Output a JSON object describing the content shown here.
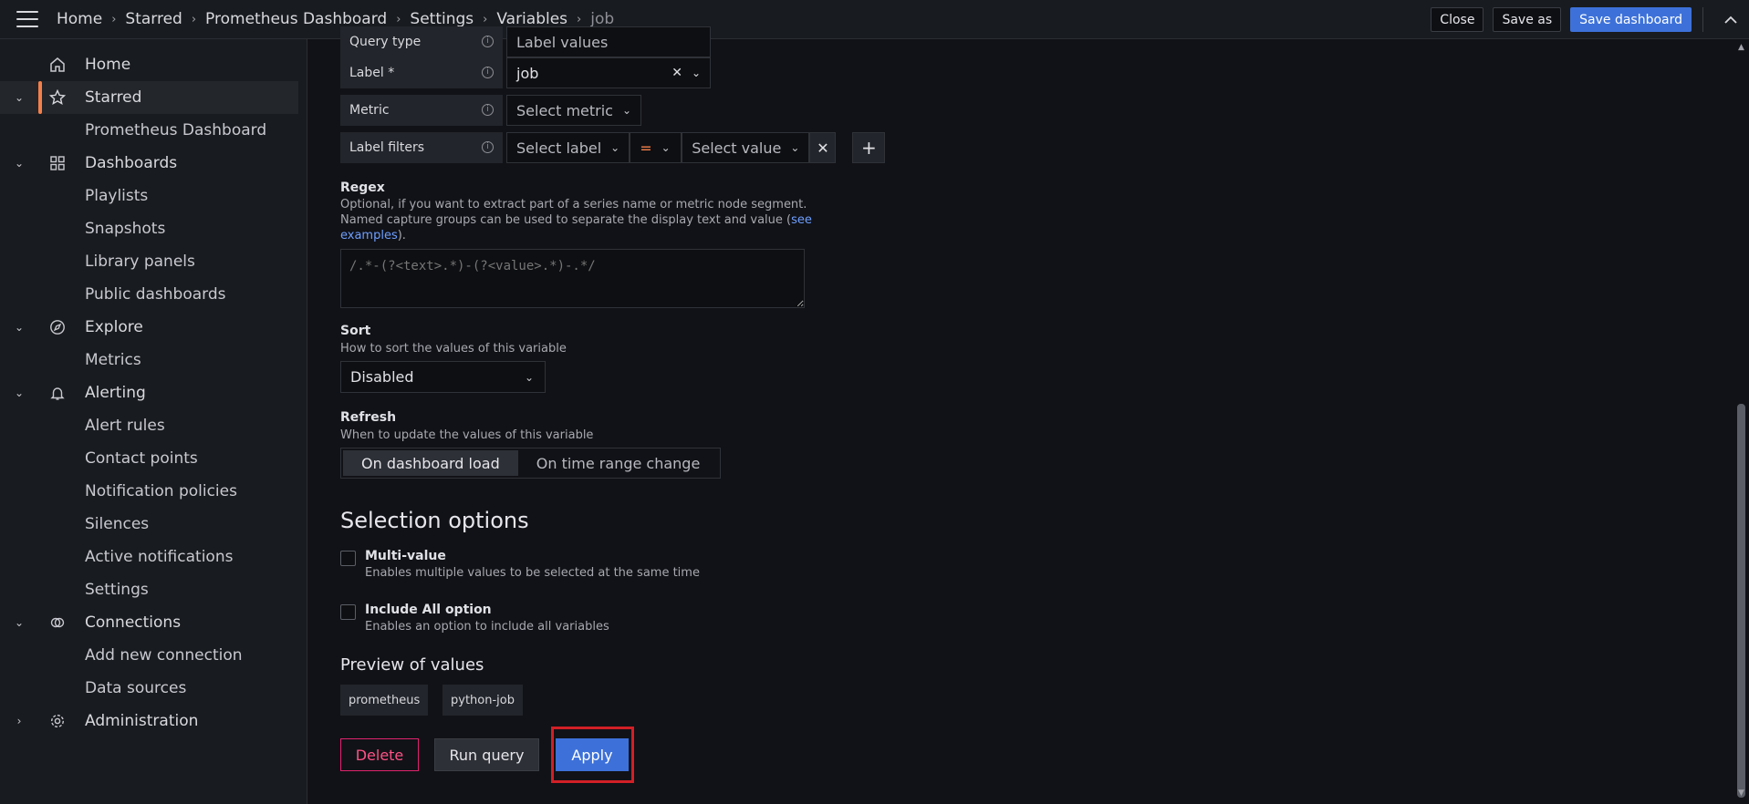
{
  "topbar": {
    "breadcrumb": [
      "Home",
      "Starred",
      "Prometheus Dashboard",
      "Settings",
      "Variables",
      "job"
    ],
    "close_label": "Close",
    "save_as_label": "Save as",
    "save_dashboard_label": "Save dashboard"
  },
  "sidebar": {
    "items": [
      {
        "label": "Home"
      },
      {
        "label": "Starred"
      },
      {
        "label": "Prometheus Dashboard"
      },
      {
        "label": "Dashboards"
      },
      {
        "label": "Playlists"
      },
      {
        "label": "Snapshots"
      },
      {
        "label": "Library panels"
      },
      {
        "label": "Public dashboards"
      },
      {
        "label": "Explore"
      },
      {
        "label": "Metrics"
      },
      {
        "label": "Alerting"
      },
      {
        "label": "Alert rules"
      },
      {
        "label": "Contact points"
      },
      {
        "label": "Notification policies"
      },
      {
        "label": "Silences"
      },
      {
        "label": "Active notifications"
      },
      {
        "label": "Settings"
      },
      {
        "label": "Connections"
      },
      {
        "label": "Add new connection"
      },
      {
        "label": "Data sources"
      },
      {
        "label": "Administration"
      }
    ]
  },
  "query": {
    "query_type_label": "Query type",
    "query_type_value": "Label values",
    "label_label": "Label *",
    "label_value": "job",
    "metric_label": "Metric",
    "metric_placeholder": "Select metric",
    "label_filters_label": "Label filters",
    "filter_label_placeholder": "Select label",
    "filter_operator": "=",
    "filter_value_placeholder": "Select value"
  },
  "regex": {
    "title": "Regex",
    "desc_line1": "Optional, if you want to extract part of a series name or metric node segment.",
    "desc_line2": "Named capture groups can be used to separate the display text and value (",
    "link_see": "see",
    "link_examples": "examples",
    "desc_end": ").",
    "placeholder": "/.*-(?<text>.*)-(?<value>.*)-.*/"
  },
  "sort": {
    "title": "Sort",
    "desc": "How to sort the values of this variable",
    "value": "Disabled"
  },
  "refresh": {
    "title": "Refresh",
    "desc": "When to update the values of this variable",
    "options": [
      "On dashboard load",
      "On time range change"
    ]
  },
  "selection": {
    "title": "Selection options",
    "multi_title": "Multi-value",
    "multi_desc": "Enables multiple values to be selected at the same time",
    "all_title": "Include All option",
    "all_desc": "Enables an option to include all variables"
  },
  "preview": {
    "title": "Preview of values",
    "values": [
      "prometheus",
      "python-job"
    ]
  },
  "actions": {
    "delete_label": "Delete",
    "run_query_label": "Run query",
    "apply_label": "Apply"
  }
}
